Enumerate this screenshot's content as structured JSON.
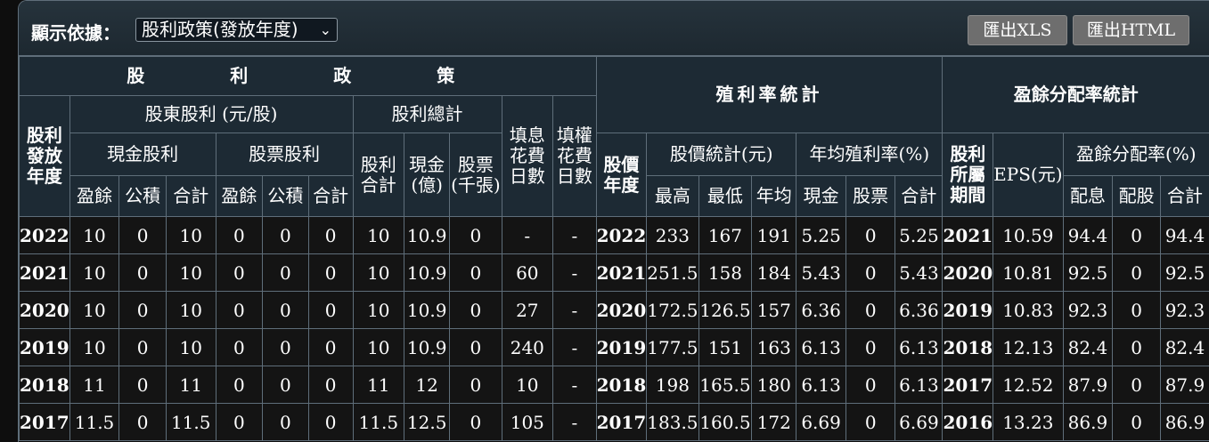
{
  "toolbar": {
    "label": "顯示依據：",
    "select_value": "股利政策(發放年度)",
    "export_xls": "匯出XLS",
    "export_html": "匯出HTML"
  },
  "header": {
    "dividend_policy": "股　利　政　策",
    "yield_stats": "殖利率統計",
    "payout_stats": "盈餘分配率統計",
    "dividend_year": "股利發放年度",
    "shareholder_dividend": "股東股利 (元/股)",
    "dividend_total": "股利總計",
    "fill_div_days": "填息花費日數",
    "fill_right_days": "填權花費日數",
    "cash_dividend": "現金股利",
    "stock_dividend": "股票股利",
    "dividend_sum": "股利合計",
    "cash_total": "現金(億)",
    "stock_total": "股票(千張)",
    "earnings": "盈餘",
    "reserve": "公積",
    "subtotal": "合計",
    "price_year": "股價年度",
    "price_stats": "股價統計(元)",
    "avg_yield": "年均殖利率(%)",
    "high": "最高",
    "low": "最低",
    "avg": "年均",
    "cash": "現金",
    "stock": "股票",
    "total": "合計",
    "profit_period": "股利所屬期間",
    "eps": "EPS(元)",
    "payout_ratio": "盈餘分配率(%)",
    "payout_cash": "配息",
    "payout_stock": "配股",
    "payout_total": "合計"
  },
  "rows": [
    [
      "2022",
      "10",
      "0",
      "10",
      "0",
      "0",
      "0",
      "10",
      "10.9",
      "0",
      "-",
      "-",
      "2022",
      "233",
      "167",
      "191",
      "5.25",
      "0",
      "5.25",
      "2021",
      "10.59",
      "94.4",
      "0",
      "94.4"
    ],
    [
      "2021",
      "10",
      "0",
      "10",
      "0",
      "0",
      "0",
      "10",
      "10.9",
      "0",
      "60",
      "-",
      "2021",
      "251.5",
      "158",
      "184",
      "5.43",
      "0",
      "5.43",
      "2020",
      "10.81",
      "92.5",
      "0",
      "92.5"
    ],
    [
      "2020",
      "10",
      "0",
      "10",
      "0",
      "0",
      "0",
      "10",
      "10.9",
      "0",
      "27",
      "-",
      "2020",
      "172.5",
      "126.5",
      "157",
      "6.36",
      "0",
      "6.36",
      "2019",
      "10.83",
      "92.3",
      "0",
      "92.3"
    ],
    [
      "2019",
      "10",
      "0",
      "10",
      "0",
      "0",
      "0",
      "10",
      "10.9",
      "0",
      "240",
      "-",
      "2019",
      "177.5",
      "151",
      "163",
      "6.13",
      "0",
      "6.13",
      "2018",
      "12.13",
      "82.4",
      "0",
      "82.4"
    ],
    [
      "2018",
      "11",
      "0",
      "11",
      "0",
      "0",
      "0",
      "11",
      "12",
      "0",
      "10",
      "-",
      "2018",
      "198",
      "165.5",
      "180",
      "6.13",
      "0",
      "6.13",
      "2017",
      "12.52",
      "87.9",
      "0",
      "87.9"
    ],
    [
      "2017",
      "11.5",
      "0",
      "11.5",
      "0",
      "0",
      "0",
      "11.5",
      "12.5",
      "0",
      "105",
      "-",
      "2017",
      "183.5",
      "160.5",
      "172",
      "6.69",
      "0",
      "6.69",
      "2016",
      "13.23",
      "86.9",
      "0",
      "86.9"
    ]
  ]
}
